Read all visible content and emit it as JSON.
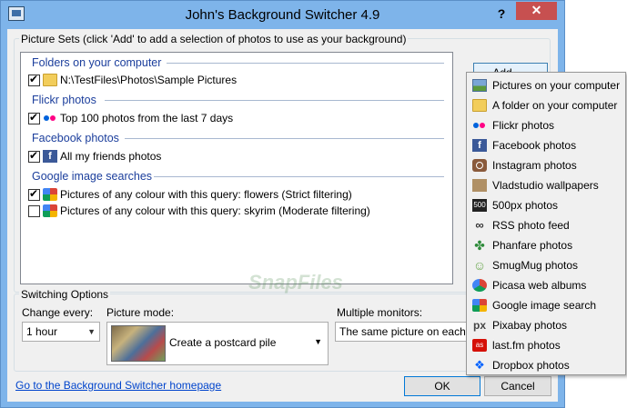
{
  "window": {
    "title": "John's Background Switcher 4.9",
    "help_label": "?",
    "close_label": "✕"
  },
  "picture_sets": {
    "group_label": "Picture Sets (click 'Add' to add a selection of photos to use as your background)",
    "add_label": "Add",
    "categories": [
      {
        "name": "Folders on your computer",
        "items": [
          {
            "checked": true,
            "icon": "folder-icon",
            "text": "N:\\TestFiles\\Photos\\Sample Pictures"
          }
        ]
      },
      {
        "name": "Flickr photos",
        "items": [
          {
            "checked": true,
            "icon": "flickr-icon",
            "text": "Top 100 photos from the last 7 days"
          }
        ]
      },
      {
        "name": "Facebook photos",
        "items": [
          {
            "checked": true,
            "icon": "facebook-icon",
            "text": "All my friends photos"
          }
        ]
      },
      {
        "name": "Google image searches",
        "items": [
          {
            "checked": true,
            "icon": "google-icon",
            "text": "Pictures of any colour with this query: flowers (Strict filtering)"
          },
          {
            "checked": false,
            "icon": "google-icon",
            "text": "Pictures of any colour with this query: skyrim (Moderate filtering)"
          }
        ]
      }
    ]
  },
  "switching": {
    "group_label": "Switching Options",
    "change_every_label": "Change every:",
    "change_every_value": "1 hour",
    "picture_mode_label": "Picture mode:",
    "picture_mode_value": "Create a postcard pile",
    "multiple_monitors_label": "Multiple monitors:",
    "multiple_monitors_value": "The same picture on each monitor"
  },
  "footer": {
    "homepage_link": "Go to the Background Switcher homepage",
    "ok_label": "OK",
    "cancel_label": "Cancel"
  },
  "add_menu": {
    "items": [
      {
        "icon": "picture-icon",
        "label": "Pictures on your computer"
      },
      {
        "icon": "folder-icon",
        "label": "A folder on your computer"
      },
      {
        "icon": "flickr-icon",
        "label": "Flickr photos"
      },
      {
        "icon": "facebook-icon",
        "label": "Facebook photos"
      },
      {
        "icon": "instagram-icon",
        "label": "Instagram photos"
      },
      {
        "icon": "vladstudio-icon",
        "label": "Vladstudio wallpapers"
      },
      {
        "icon": "500px-icon",
        "label": "500px photos"
      },
      {
        "icon": "rss-icon",
        "label": "RSS photo feed"
      },
      {
        "icon": "phanfare-icon",
        "label": "Phanfare photos"
      },
      {
        "icon": "smugmug-icon",
        "label": "SmugMug photos"
      },
      {
        "icon": "picasa-icon",
        "label": "Picasa web albums"
      },
      {
        "icon": "google-icon",
        "label": "Google image search"
      },
      {
        "icon": "pixabay-icon",
        "label": "Pixabay photos"
      },
      {
        "icon": "lastfm-icon",
        "label": "last.fm photos"
      },
      {
        "icon": "dropbox-icon",
        "label": "Dropbox photos"
      }
    ]
  },
  "watermark": "SnapFiles"
}
